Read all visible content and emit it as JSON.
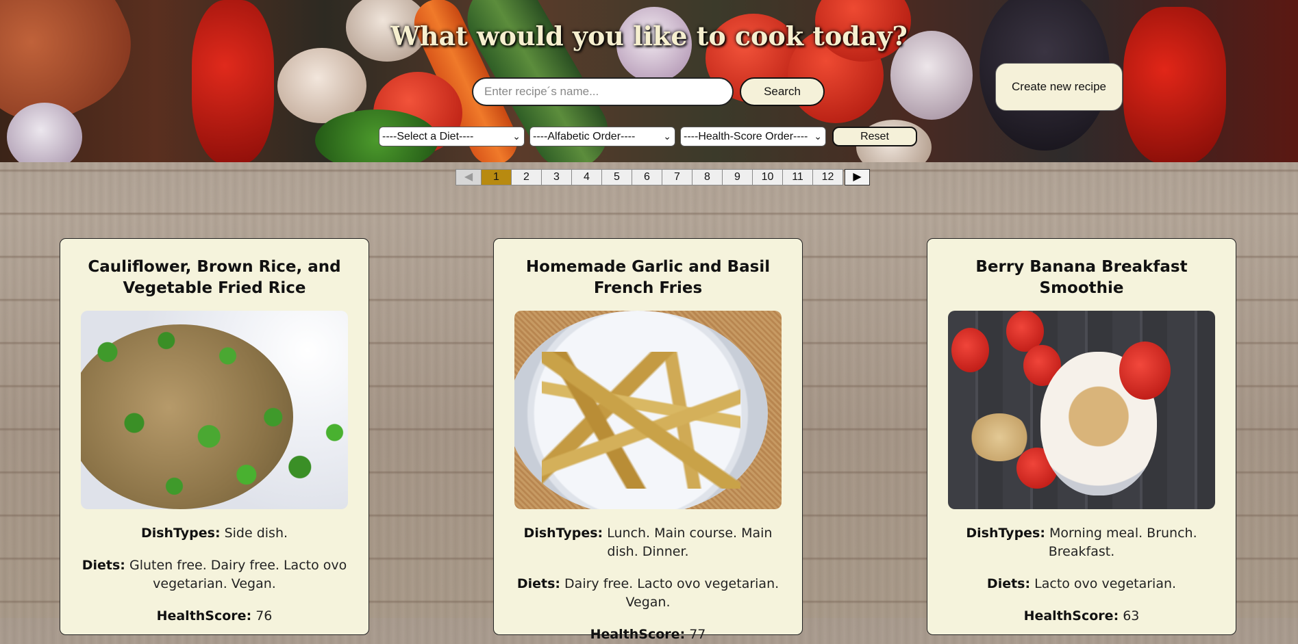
{
  "header": {
    "title": "What would you like to cook today?",
    "search_placeholder": "Enter recipe´s name...",
    "search_button": "Search",
    "create_button": "Create new recipe",
    "diet_select": "----Select a Diet----",
    "alpha_select": "----Alfabetic Order----",
    "health_select": "----Health-Score Order----",
    "reset_button": "Reset"
  },
  "pagination": {
    "prev": "◀",
    "pages": [
      "1",
      "2",
      "3",
      "4",
      "5",
      "6",
      "7",
      "8",
      "9",
      "10",
      "11",
      "12"
    ],
    "active_page": "1",
    "next": "▶"
  },
  "labels": {
    "dish_types": "DishTypes:",
    "diets": "Diets:",
    "health_score": "HealthScore:"
  },
  "cards": [
    {
      "title": "Cauliflower, Brown Rice, and Vegetable Fried Rice",
      "dish_types": "Side dish.",
      "diets": "Gluten free. Dairy free. Lacto ovo vegetarian. Vegan.",
      "health_score": "76"
    },
    {
      "title": "Homemade Garlic and Basil French Fries",
      "dish_types": "Lunch. Main course. Main dish. Dinner.",
      "diets": "Dairy free. Lacto ovo vegetarian. Vegan.",
      "health_score": "77"
    },
    {
      "title": "Berry Banana Breakfast Smoothie",
      "dish_types": "Morning meal. Brunch. Breakfast.",
      "diets": "Lacto ovo vegetarian.",
      "health_score": "63"
    }
  ]
}
